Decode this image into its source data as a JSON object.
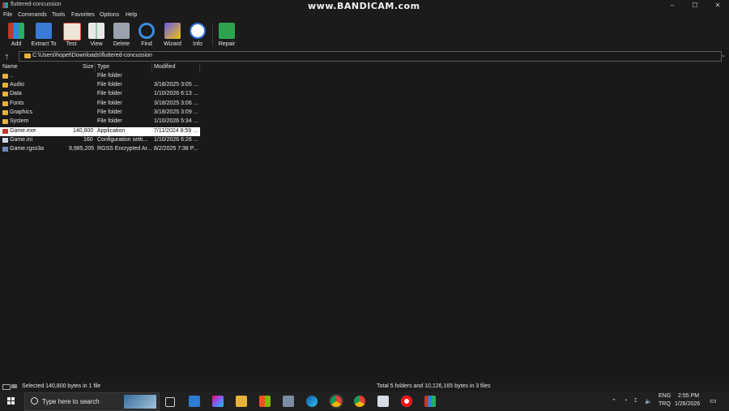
{
  "window": {
    "title": "fluttered-concussion",
    "watermark": "www.BANDICAM.com",
    "controls": {
      "minimize": "–",
      "maximize": "☐",
      "close": "✕"
    }
  },
  "menu": [
    "File",
    "Commands",
    "Tools",
    "Favorites",
    "Options",
    "Help"
  ],
  "toolbar": [
    {
      "label": "Add",
      "icon": "archive-add-icon",
      "color": "#c0392b"
    },
    {
      "label": "Extract To",
      "icon": "folder-extract-icon",
      "color": "#3a7bd5"
    },
    {
      "label": "Test",
      "icon": "clipboard-check-icon",
      "color": "#d94c3d"
    },
    {
      "label": "View",
      "icon": "book-view-icon",
      "color": "#4aa86b"
    },
    {
      "label": "Delete",
      "icon": "trash-icon",
      "color": "#9aa3ad"
    },
    {
      "label": "Find",
      "icon": "magnifier-icon",
      "color": "#3b8de0"
    },
    {
      "label": "Wizard",
      "icon": "magic-wand-icon",
      "color": "#6c5ce7"
    },
    {
      "label": "Info",
      "icon": "info-icon",
      "color": "#2d6fd1"
    },
    {
      "label": "Repair",
      "icon": "first-aid-icon",
      "color": "#2ea44f"
    }
  ],
  "address": {
    "up": "🡑",
    "path": "C:\\Users\\hopet\\Downloads\\fluttered-concussion",
    "chevron": "⌄"
  },
  "columns": {
    "name": "Name",
    "size": "Size",
    "type": "Type",
    "modified": "Modified"
  },
  "files": [
    {
      "name": "..",
      "size": "",
      "type": "File folder",
      "modified": "",
      "icon": "folder"
    },
    {
      "name": "Audio",
      "size": "",
      "type": "File folder",
      "modified": "3/18/2025 3:05 ...",
      "icon": "folder"
    },
    {
      "name": "Data",
      "size": "",
      "type": "File folder",
      "modified": "1/10/2026 6:13 ...",
      "icon": "folder"
    },
    {
      "name": "Fonts",
      "size": "",
      "type": "File folder",
      "modified": "3/18/2025 3:06 ...",
      "icon": "folder"
    },
    {
      "name": "Graphics",
      "size": "",
      "type": "File folder",
      "modified": "3/18/2025 3:09 ...",
      "icon": "folder"
    },
    {
      "name": "System",
      "size": "",
      "type": "File folder",
      "modified": "1/10/2026 5:34 ...",
      "icon": "folder"
    },
    {
      "name": "Game.exe",
      "size": "140,800",
      "type": "Application",
      "modified": "7/11/2024 8:59 ...",
      "icon": "exe",
      "selected": true
    },
    {
      "name": "Game.ini",
      "size": "160",
      "type": "Configuration setti...",
      "modified": "1/10/2026 6:26 ...",
      "icon": "file"
    },
    {
      "name": "Game.rgss3a",
      "size": "9,985,205",
      "type": "RGSS Encrypted Ar...",
      "modified": "8/2/2025 7:38 P...",
      "icon": "rgss"
    }
  ],
  "status": {
    "left": "Selected 140,800 bytes in 1 file",
    "right": "Total 5 folders and 10,126,165 bytes in 3 files"
  },
  "taskbar": {
    "search_placeholder": "Type here to search",
    "apps": [
      "task-view-icon",
      "mail-icon",
      "copilot-icon",
      "file-explorer-icon",
      "store-icon",
      "screen-icon",
      "edge-icon",
      "chrome-icon",
      "chrome-icon",
      "drive-icon",
      "record-icon",
      "winrar-icon"
    ],
    "tray": {
      "lang1": "ENG",
      "lang2": "TRQ",
      "time": "2:55 PM",
      "date": "1/26/2026"
    }
  }
}
